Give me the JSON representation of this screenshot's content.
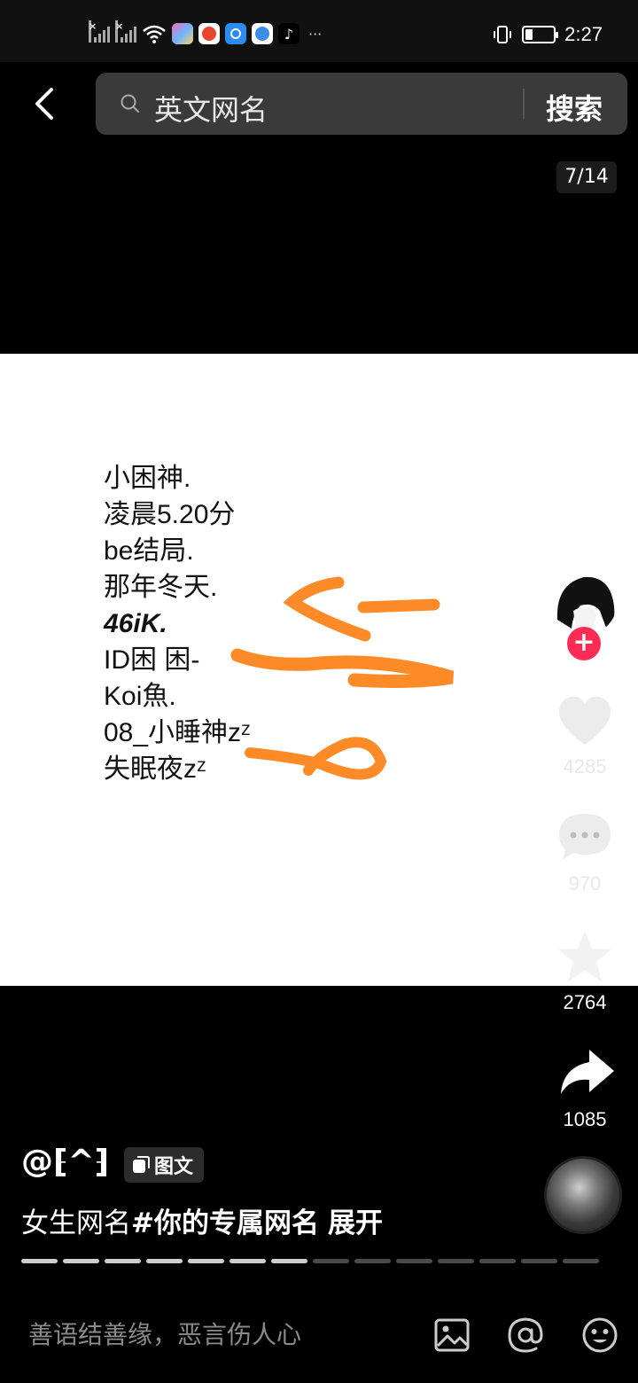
{
  "status_bar": {
    "time": "2:27",
    "more_icons": "···"
  },
  "search": {
    "query": "英文网名",
    "button_label": "搜索"
  },
  "page_counter": "7/14",
  "image": {
    "names": [
      "小困神.",
      "凌晨5.20分",
      "be结局.",
      "那年冬天.",
      "46iK.",
      "ID困 困-",
      "Koi魚.",
      "08_小睡神zᶻ",
      "失眠夜zᶻ"
    ]
  },
  "actions": {
    "like_count": "4285",
    "comment_count": "970",
    "favorite_count": "2764",
    "share_count": "1085",
    "follow_symbol": "+"
  },
  "post": {
    "author": "@⁅^⁆",
    "badge": "图文",
    "caption_text": "女生网名",
    "caption_tag": "#你的专属网名",
    "expand_label": "展开",
    "progress_current": 7,
    "progress_total": 14
  },
  "comment": {
    "placeholder": "善语结善缘，恶言伤人心"
  },
  "colors": {
    "accent": "#fe2c55",
    "scribble": "#ff8a28",
    "search_bg": "#3a3a3a"
  }
}
